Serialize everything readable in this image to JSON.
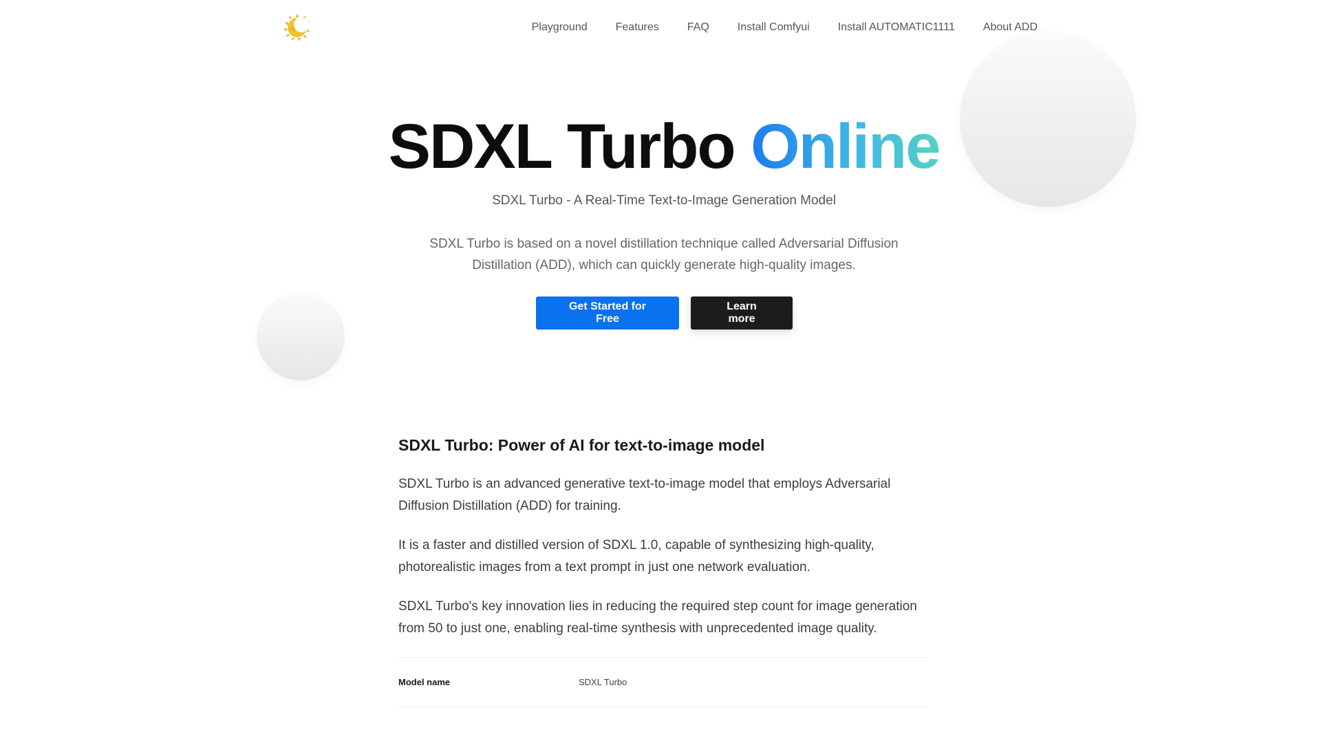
{
  "header": {
    "logo_icon": "crescent-moon-sun-logo-icon",
    "nav": [
      {
        "label": "Playground"
      },
      {
        "label": "Features"
      },
      {
        "label": "FAQ"
      },
      {
        "label": "Install Comfyui"
      },
      {
        "label": "Install AUTOMATIC1111"
      },
      {
        "label": "About ADD"
      }
    ]
  },
  "hero": {
    "title_main": "SDXL Turbo",
    "title_accent": "Online",
    "subtitle": "SDXL Turbo - A Real-Time Text-to-Image Generation Model",
    "description": "SDXL Turbo is based on a novel distillation technique called Adversarial Diffusion Distillation (ADD), which can quickly generate high-quality images.",
    "primary_button": "Get Started for Free",
    "secondary_button": "Learn more"
  },
  "section": {
    "heading": "SDXL Turbo: Power of AI for text-to-image model",
    "paragraphs": [
      "SDXL Turbo is an advanced generative text-to-image model that employs Adversarial Diffusion Distillation (ADD) for training.",
      "It is a faster and distilled version of SDXL 1.0, capable of synthesizing high-quality, photorealistic images from a text prompt in just one network evaluation.",
      "SDXL Turbo's key innovation lies in reducing the required step count for image generation from 50 to just one, enabling real-time synthesis with unprecedented image quality."
    ],
    "specs": [
      {
        "key": "Model name",
        "value": "SDXL Turbo"
      }
    ]
  },
  "colors": {
    "primary": "#0a72ef",
    "dark_button": "#1c1c1c",
    "accent_gradient_start": "#1e7bf0",
    "accent_gradient_end": "#54d1c4"
  }
}
